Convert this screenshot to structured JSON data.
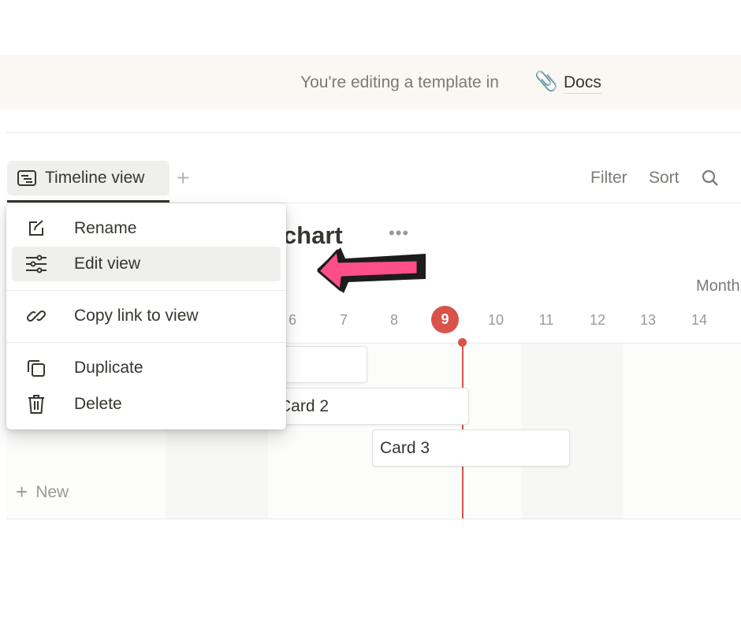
{
  "banner": {
    "text": "You're editing a template in",
    "icon": "paperclip-icon",
    "link": "Docs"
  },
  "tabs": [
    {
      "label": "Timeline view",
      "icon": "timeline-icon",
      "active": true
    }
  ],
  "toolbar": {
    "filter": "Filter",
    "sort": "Sort",
    "search_icon": "search-icon"
  },
  "page": {
    "title_visible": "t chart",
    "more": "•••"
  },
  "timeline": {
    "zoom": "Month",
    "days": [
      "6",
      "7",
      "8",
      "9",
      "10",
      "11",
      "12",
      "13",
      "14"
    ],
    "today": "9",
    "today_color": "#d9534a",
    "cards": [
      {
        "label": ""
      },
      {
        "label": "Card 2"
      },
      {
        "label": "Card 3"
      }
    ],
    "new_label": "New"
  },
  "menu": {
    "items": [
      {
        "label": "Rename",
        "icon": "edit-icon"
      },
      {
        "label": "Edit view",
        "icon": "sliders-icon",
        "highlighted": true
      },
      {
        "label": "Copy link to view",
        "icon": "link-icon"
      },
      {
        "label": "Duplicate",
        "icon": "duplicate-icon"
      },
      {
        "label": "Delete",
        "icon": "trash-icon"
      }
    ]
  },
  "annotation": {
    "arrow_color": "#ff4f8b",
    "arrow_icon": "arrow-left-icon"
  }
}
